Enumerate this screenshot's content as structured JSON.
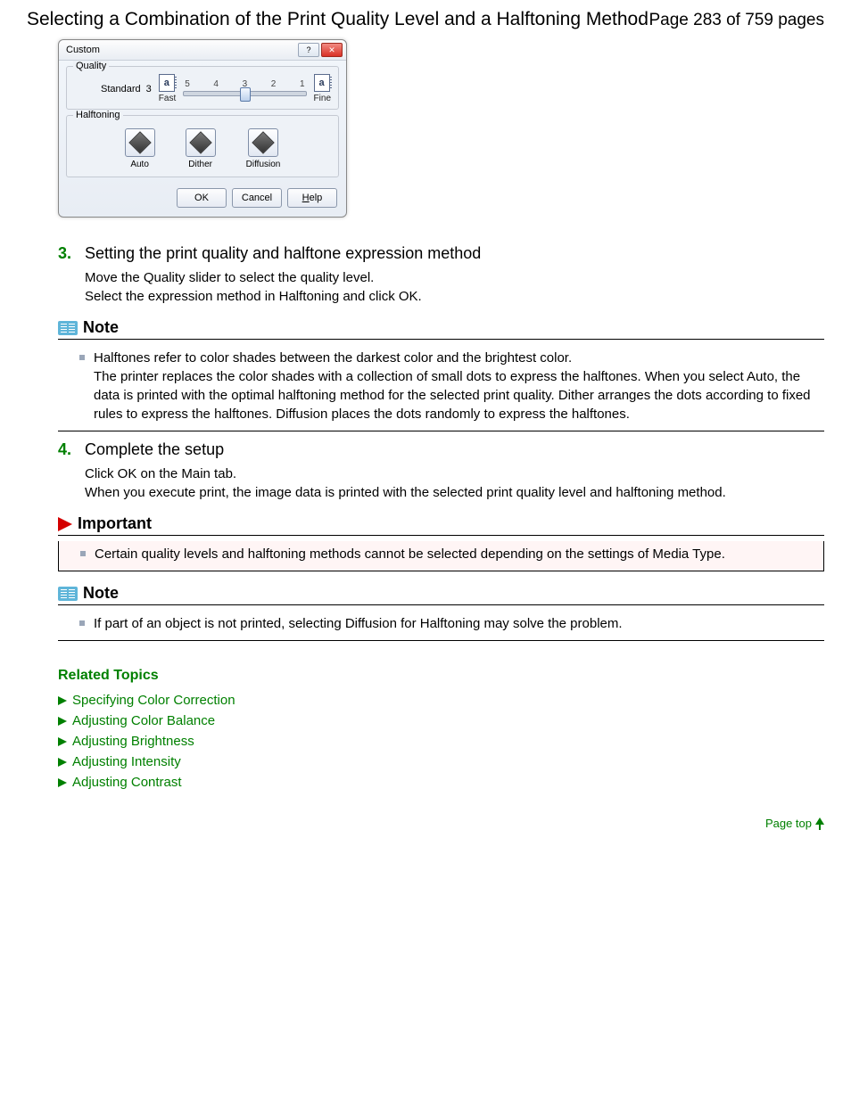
{
  "header": {
    "title": "Selecting a Combination of the Print Quality Level and a Halftoning Method",
    "page_indicator": "Page 283 of 759 pages"
  },
  "dialog": {
    "title": "Custom",
    "quality_label": "Quality",
    "standard_label": "Standard",
    "standard_value": "3",
    "ticks": [
      "5",
      "4",
      "3",
      "2",
      "1"
    ],
    "fast_label": "Fast",
    "fine_label": "Fine",
    "icon_glyph": "a",
    "halftoning_label": "Halftoning",
    "halftone_options": [
      "Auto",
      "Dither",
      "Diffusion"
    ],
    "buttons": {
      "ok": "OK",
      "cancel": "Cancel",
      "help": "Help"
    }
  },
  "steps": [
    {
      "num": "3.",
      "title": "Setting the print quality and halftone expression method",
      "body": "Move the Quality slider to select the quality level.\nSelect the expression method in Halftoning and click OK."
    },
    {
      "num": "4.",
      "title": "Complete the setup",
      "body": "Click OK on the Main tab.\nWhen you execute print, the image data is printed with the selected print quality level and halftoning method."
    }
  ],
  "notes": {
    "note1_title": "Note",
    "note1_body": "Halftones refer to color shades between the darkest color and the brightest color.\nThe printer replaces the color shades with a collection of small dots to express the halftones. When you select Auto, the data is printed with the optimal halftoning method for the selected print quality. Dither arranges the dots according to fixed rules to express the halftones. Diffusion places the dots randomly to express the halftones.",
    "important_title": "Important",
    "important_body": "Certain quality levels and halftoning methods cannot be selected depending on the settings of Media Type.",
    "note2_title": "Note",
    "note2_body": "If part of an object is not printed, selecting Diffusion for Halftoning may solve the problem."
  },
  "related": {
    "title": "Related Topics",
    "items": [
      "Specifying Color Correction",
      "Adjusting Color Balance",
      "Adjusting Brightness",
      "Adjusting Intensity",
      "Adjusting Contrast"
    ]
  },
  "page_top": "Page top"
}
